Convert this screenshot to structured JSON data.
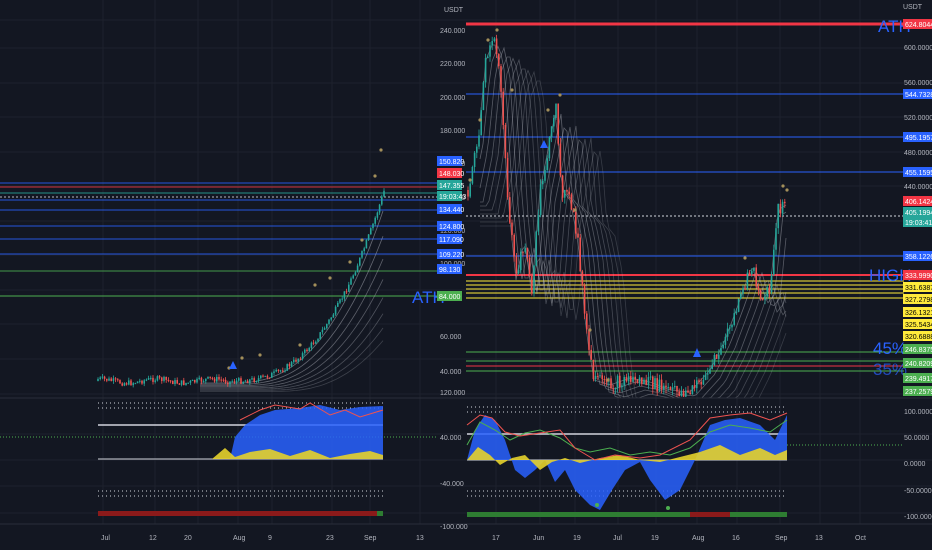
{
  "colors": {
    "background": "#131722",
    "grid": "#1e222d",
    "axis_text": "#b2b5be",
    "bull": "#26a69a",
    "bear": "#ef5350",
    "level_blue": "#2962ff",
    "level_red": "#f23645",
    "level_green": "#4caf50",
    "level_yellow": "#ffeb3b",
    "ribbon": "#b2b5be",
    "osc_blue": "#2962ff",
    "osc_yellow": "#e6d22b",
    "osc_green": "#4caf50"
  },
  "left_chart": {
    "currency": "USDT",
    "x_ticks": [
      "Jul",
      "12",
      "20",
      "Aug",
      "9",
      "23",
      "Sep",
      "13"
    ],
    "y_ticks": [
      "240.000",
      "220.000",
      "200.000",
      "180.000",
      "160.000",
      "140.000",
      "120.000",
      "100.000",
      "80.000",
      "60.000",
      "40.000",
      "120.000"
    ],
    "osc_ticks": [
      "40.000",
      "-40.000",
      "-100.000"
    ],
    "labels": [
      {
        "text": "150.820",
        "color": "#2962ff"
      },
      {
        "text": "148.030",
        "color": "#f23645"
      },
      {
        "text": "147.355",
        "color": "#26a69a"
      },
      {
        "text": "19:03:43",
        "color": "#26a69a"
      },
      {
        "text": "134.440",
        "color": "#2962ff"
      },
      {
        "text": "124.800",
        "color": "#2962ff"
      },
      {
        "text": "117.090",
        "color": "#2962ff"
      },
      {
        "text": "109.220",
        "color": "#2962ff"
      },
      {
        "text": "98.130",
        "color": "#2962ff"
      },
      {
        "text": "84.000",
        "color": "#4caf50"
      }
    ],
    "watermarks": [
      {
        "text": "ATH"
      }
    ]
  },
  "right_chart": {
    "currency": "USDT",
    "x_ticks": [
      "17",
      "Jun",
      "19",
      "Jul",
      "19",
      "Aug",
      "16",
      "Sep",
      "13",
      "Oct"
    ],
    "y_ticks": [
      "600.0000",
      "560.0000",
      "520.0000",
      "480.0000",
      "440.0000",
      "360.0000"
    ],
    "osc_ticks": [
      "100.0000",
      "50.0000",
      "0.0000",
      "-50.0000",
      "-100.0000"
    ],
    "labels": [
      {
        "text": "624.8044",
        "color": "#f23645"
      },
      {
        "text": "544.7328",
        "color": "#2962ff"
      },
      {
        "text": "495.1957",
        "color": "#2962ff"
      },
      {
        "text": "455.1595",
        "color": "#2962ff"
      },
      {
        "text": "406.1424",
        "color": "#f23645"
      },
      {
        "text": "405.1994",
        "color": "#26a69a"
      },
      {
        "text": "19:03:41",
        "color": "#26a69a"
      },
      {
        "text": "358.1226",
        "color": "#2962ff"
      },
      {
        "text": "333.9990",
        "color": "#f23645"
      },
      {
        "text": "331.6387",
        "color": "#ffeb3b"
      },
      {
        "text": "327.2798",
        "color": "#ffeb3b"
      },
      {
        "text": "326.1321",
        "color": "#ffeb3b"
      },
      {
        "text": "325.5434",
        "color": "#ffeb3b"
      },
      {
        "text": "320.6888",
        "color": "#ffeb3b"
      },
      {
        "text": "246.8375",
        "color": "#4caf50"
      },
      {
        "text": "240.8209",
        "color": "#4caf50"
      },
      {
        "text": "239.4917",
        "color": "#4caf50"
      },
      {
        "text": "237.2579",
        "color": "#4caf50"
      }
    ],
    "watermarks": [
      {
        "text": "ATH"
      },
      {
        "text": "HIGH"
      },
      {
        "text": "45%"
      },
      {
        "text": "35%"
      }
    ]
  }
}
